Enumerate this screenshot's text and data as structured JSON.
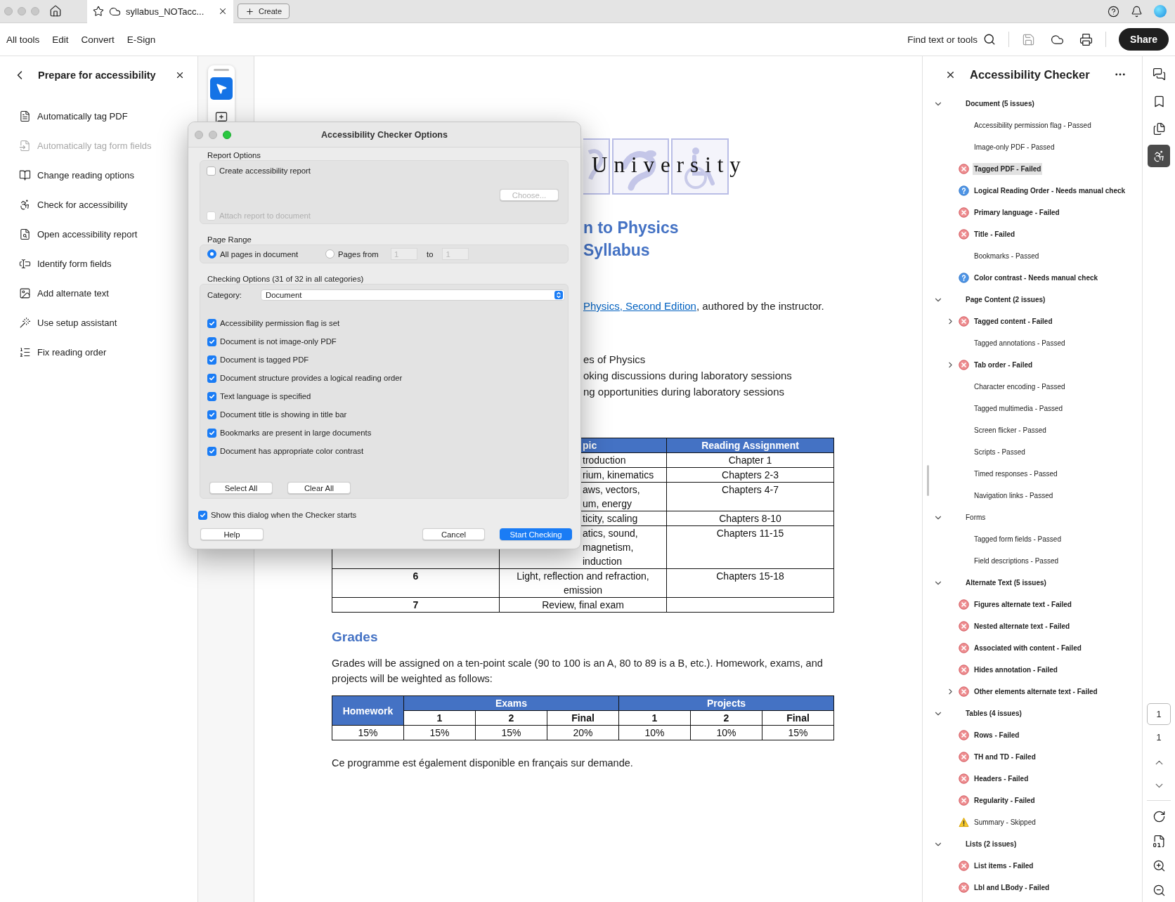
{
  "tab_bar": {
    "tab_title": "syllabus_NOTacc...",
    "create": "Create"
  },
  "menu": [
    {
      "label": "All tools"
    },
    {
      "label": "Edit"
    },
    {
      "label": "Convert"
    },
    {
      "label": "E-Sign"
    }
  ],
  "find": "Find text or tools",
  "share": "Share",
  "left_panel": {
    "title": "Prepare for accessibility",
    "items": [
      {
        "label": "Automatically tag PDF",
        "disabled": false
      },
      {
        "label": "Automatically tag form fields",
        "disabled": true
      },
      {
        "label": "Change reading options",
        "disabled": false
      },
      {
        "label": "Check for accessibility",
        "disabled": false
      },
      {
        "label": "Open accessibility report",
        "disabled": false
      },
      {
        "label": "Identify form fields",
        "disabled": false
      },
      {
        "label": "Add alternate text",
        "disabled": false
      },
      {
        "label": "Use setup assistant",
        "disabled": false
      },
      {
        "label": "Fix reading order",
        "disabled": false
      }
    ]
  },
  "tools": [
    {
      "selected": true
    },
    {
      "selected": false
    }
  ],
  "document": {
    "logo_text": "University",
    "title_lines": [
      "n to Physics",
      "Syllabus"
    ],
    "textbook": {
      "link": "Physics, Second Edition",
      "text": ", authored by the instructor."
    },
    "bullets": [
      "es of Physics",
      "oking discussions during laboratory sessions",
      "ng opportunities during laboratory sessions"
    ],
    "schedule": {
      "columns": [
        "pic",
        "Reading Assignment"
      ],
      "rows": [
        {
          "topic": [
            "troduction"
          ],
          "reading": "Chapter 1"
        },
        {
          "topic": [
            "rium, kinematics"
          ],
          "reading": "Chapters 2-3"
        },
        {
          "topic": [
            "aws, vectors,",
            "um, energy"
          ],
          "reading": "Chapters 4-7"
        },
        {
          "topic": [
            "ticity, scaling"
          ],
          "reading": "Chapters 8-10"
        },
        {
          "topic": [
            "atics, sound,",
            "magnetism,",
            "induction"
          ],
          "reading": "Chapters 11-15"
        },
        {
          "week": "6",
          "topic": [
            "Light, reflection and refraction,",
            "emission"
          ],
          "reading": "Chapters 15-18"
        },
        {
          "week": "7",
          "topic": [
            "Review, final exam"
          ]
        }
      ]
    },
    "grades_heading": "Grades",
    "grades_text": "Grades will be assigned on a ten-point scale (90 to 100 is an A, 80 to 89 is a B, etc.). Homework, exams, and projects will be weighted as follows:",
    "weights": {
      "first": "Homework",
      "groups": [
        {
          "label": "Exams",
          "columns": [
            "1",
            "2",
            "Final"
          ]
        },
        {
          "label": "Projects",
          "columns": [
            "1",
            "2",
            "Final"
          ]
        }
      ],
      "values": [
        "15%",
        "15%",
        "15%",
        "20%",
        "10%",
        "10%",
        "15%"
      ]
    },
    "note": "Ce programme est également disponible en français sur demande."
  },
  "dialog": {
    "title": "Accessibility Checker Options",
    "report": {
      "label": "Report Options",
      "create": {
        "label": "Create accessibility report",
        "checked": false
      },
      "choose": {
        "label": "Choose...",
        "disabled": true
      },
      "attach": {
        "label": "Attach report to document",
        "checked": false,
        "disabled": true
      }
    },
    "page_range": {
      "label": "Page Range",
      "options": [
        {
          "label": "All pages in document",
          "selected": true
        },
        {
          "label": "Pages from",
          "selected": false
        }
      ],
      "from": {
        "value": "1",
        "disabled": true
      },
      "to_label": "to",
      "to": {
        "value": "1",
        "disabled": true
      }
    },
    "checking": {
      "label": "Checking Options (31 of 32 in all categories)",
      "category_label": "Category:",
      "category": "Document",
      "options": [
        {
          "label": "Accessibility permission flag is set",
          "checked": true
        },
        {
          "label": "Document is not image-only PDF",
          "checked": true
        },
        {
          "label": "Document is tagged PDF",
          "checked": true
        },
        {
          "label": "Document structure provides a logical reading order",
          "checked": true
        },
        {
          "label": "Text language is specified",
          "checked": true
        },
        {
          "label": "Document title is showing in title bar",
          "checked": true
        },
        {
          "label": "Bookmarks are present in large documents",
          "checked": true
        },
        {
          "label": "Document has appropriate color contrast",
          "checked": true
        }
      ],
      "select_all": "Select All",
      "clear_all": "Clear All"
    },
    "show_dialog": {
      "label": "Show this dialog when the Checker starts",
      "checked": true
    },
    "buttons": [
      {
        "label": "Help",
        "kind": "plain"
      },
      {
        "label": "Cancel",
        "kind": "plain"
      },
      {
        "label": "Start Checking",
        "kind": "primary"
      }
    ]
  },
  "checker": {
    "title": "Accessibility Checker",
    "categories": [
      {
        "label": "Document (5 issues)",
        "expanded": true,
        "children": [
          {
            "label": "Accessibility permission flag - Passed",
            "kind": "passed",
            "selected": false
          },
          {
            "label": "Image-only PDF - Passed",
            "kind": "passed",
            "selected": false
          },
          {
            "label": "Tagged PDF - Failed",
            "kind": "failed",
            "selected": true
          },
          {
            "label": "Logical Reading Order - Needs manual check",
            "kind": "manual",
            "selected": false
          },
          {
            "label": "Primary language - Failed",
            "kind": "failed",
            "selected": false
          },
          {
            "label": "Title - Failed",
            "kind": "failed",
            "selected": false
          },
          {
            "label": "Bookmarks - Passed",
            "kind": "passed",
            "selected": false
          },
          {
            "label": "Color contrast - Needs manual check",
            "kind": "manual",
            "selected": false
          }
        ]
      },
      {
        "label": "Page Content (2 issues)",
        "expanded": true,
        "children": [
          {
            "label": "Tagged content - Failed",
            "kind": "failed",
            "selected": false,
            "expanded": false
          },
          {
            "label": "Tagged annotations - Passed",
            "kind": "passed",
            "selected": false
          },
          {
            "label": "Tab order - Failed",
            "kind": "failed",
            "selected": false,
            "expanded": false
          },
          {
            "label": "Character encoding - Passed",
            "kind": "passed",
            "selected": false
          },
          {
            "label": "Tagged multimedia - Passed",
            "kind": "passed",
            "selected": false
          },
          {
            "label": "Screen flicker - Passed",
            "kind": "passed",
            "selected": false
          },
          {
            "label": "Scripts - Passed",
            "kind": "passed",
            "selected": false
          },
          {
            "label": "Timed responses - Passed",
            "kind": "passed",
            "selected": false
          },
          {
            "label": "Navigation links - Passed",
            "kind": "passed",
            "selected": false
          }
        ]
      },
      {
        "label": "Forms",
        "expanded": true,
        "children": [
          {
            "label": "Tagged form fields - Passed",
            "kind": "passed",
            "selected": false
          },
          {
            "label": "Field descriptions - Passed",
            "kind": "passed",
            "selected": false
          }
        ]
      },
      {
        "label": "Alternate Text (5 issues)",
        "expanded": true,
        "children": [
          {
            "label": "Figures alternate text - Failed",
            "kind": "failed",
            "selected": false
          },
          {
            "label": "Nested alternate text - Failed",
            "kind": "failed",
            "selected": false
          },
          {
            "label": "Associated with content - Failed",
            "kind": "failed",
            "selected": false
          },
          {
            "label": "Hides annotation - Failed",
            "kind": "failed",
            "selected": false
          },
          {
            "label": "Other elements alternate text - Failed",
            "kind": "failed",
            "selected": false,
            "expanded": false
          }
        ]
      },
      {
        "label": "Tables (4 issues)",
        "expanded": true,
        "children": [
          {
            "label": "Rows - Failed",
            "kind": "failed",
            "selected": false
          },
          {
            "label": "TH and TD - Failed",
            "kind": "failed",
            "selected": false
          },
          {
            "label": "Headers - Failed",
            "kind": "failed",
            "selected": false
          },
          {
            "label": "Regularity - Failed",
            "kind": "failed",
            "selected": false
          },
          {
            "label": "Summary - Skipped",
            "kind": "skipped",
            "selected": false
          }
        ]
      },
      {
        "label": "Lists (2 issues)",
        "expanded": true,
        "children": [
          {
            "label": "List items - Failed",
            "kind": "failed",
            "selected": false
          },
          {
            "label": "Lbl and LBody - Failed",
            "kind": "failed",
            "selected": false
          }
        ]
      }
    ]
  },
  "rail": [
    {
      "selected": false
    },
    {
      "selected": false
    },
    {
      "selected": false
    },
    {
      "selected": true
    }
  ],
  "page_nav": {
    "current": "1",
    "total": "1"
  }
}
